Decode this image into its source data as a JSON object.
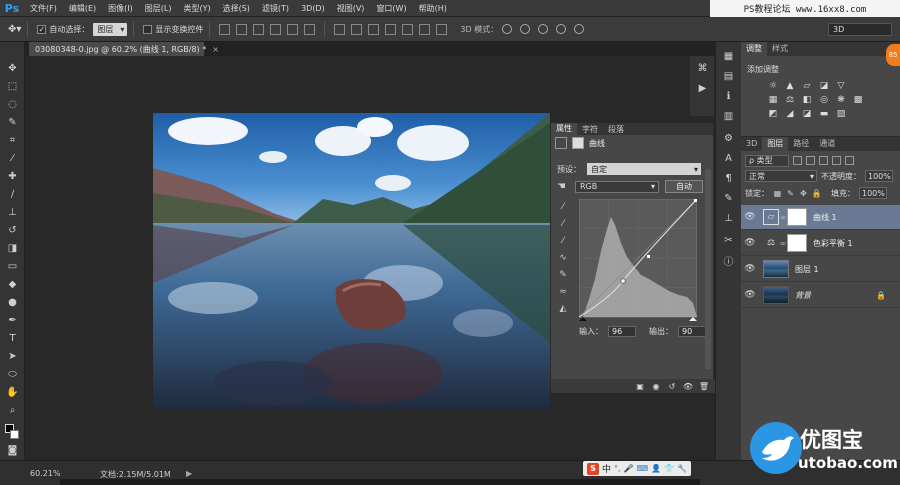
{
  "app": {
    "logo": "Ps",
    "menu": [
      "文件(F)",
      "编辑(E)",
      "图像(I)",
      "图层(L)",
      "类型(Y)",
      "选择(S)",
      "滤镜(T)",
      "3D(D)",
      "视图(V)",
      "窗口(W)",
      "帮助(H)"
    ],
    "site_banner": "PS教程论坛 www.16xx8.com"
  },
  "options": {
    "auto_select_label": "自动选择：",
    "auto_select_value": "图层",
    "show_transform_label": "显示变换控件",
    "mode3d_label": "3D 模式：",
    "workspace": "3D"
  },
  "document": {
    "tab_title": "03080348-0.jpg @ 60.2% (曲线 1, RGB/8) *",
    "tab_close": "×"
  },
  "properties": {
    "tabs": [
      "属性",
      "字符",
      "段落"
    ],
    "header_title": "曲线",
    "preset_label": "预设：",
    "preset_value": "自定",
    "channel_value": "RGB",
    "auto_label": "自动",
    "input_label": "输入：",
    "input_value": "96",
    "output_label": "输出：",
    "output_value": "90"
  },
  "adjustments": {
    "tabs": [
      "调整",
      "样式"
    ],
    "title": "添加调整"
  },
  "layers": {
    "tabs": [
      "3D",
      "图层",
      "路径",
      "通道"
    ],
    "kind_filter": "ρ 类型",
    "blend_mode": "正常",
    "opacity_label": "不透明度：",
    "opacity_value": "100%",
    "lock_label": "锁定：",
    "fill_label": "填充：",
    "fill_value": "100%",
    "items": [
      {
        "name": "曲线 1",
        "type": "curves",
        "selected": true
      },
      {
        "name": "色彩平衡 1",
        "type": "color-balance",
        "selected": false
      },
      {
        "name": "图层 1",
        "type": "image",
        "selected": false
      },
      {
        "name": "背景",
        "type": "background",
        "selected": false
      }
    ]
  },
  "status": {
    "zoom": "60.21%",
    "doc_size": "文档:2.15M/5.01M",
    "arrow": "▶"
  },
  "ime": {
    "brand": "S",
    "lang": "中"
  },
  "watermark": {
    "name": "优图宝",
    "url": "utobao.com"
  },
  "badge": "85",
  "colors": {
    "accent_blue": "#2b96e3",
    "selection": "#6a7a94",
    "ps_blue": "#2fa3f3"
  }
}
